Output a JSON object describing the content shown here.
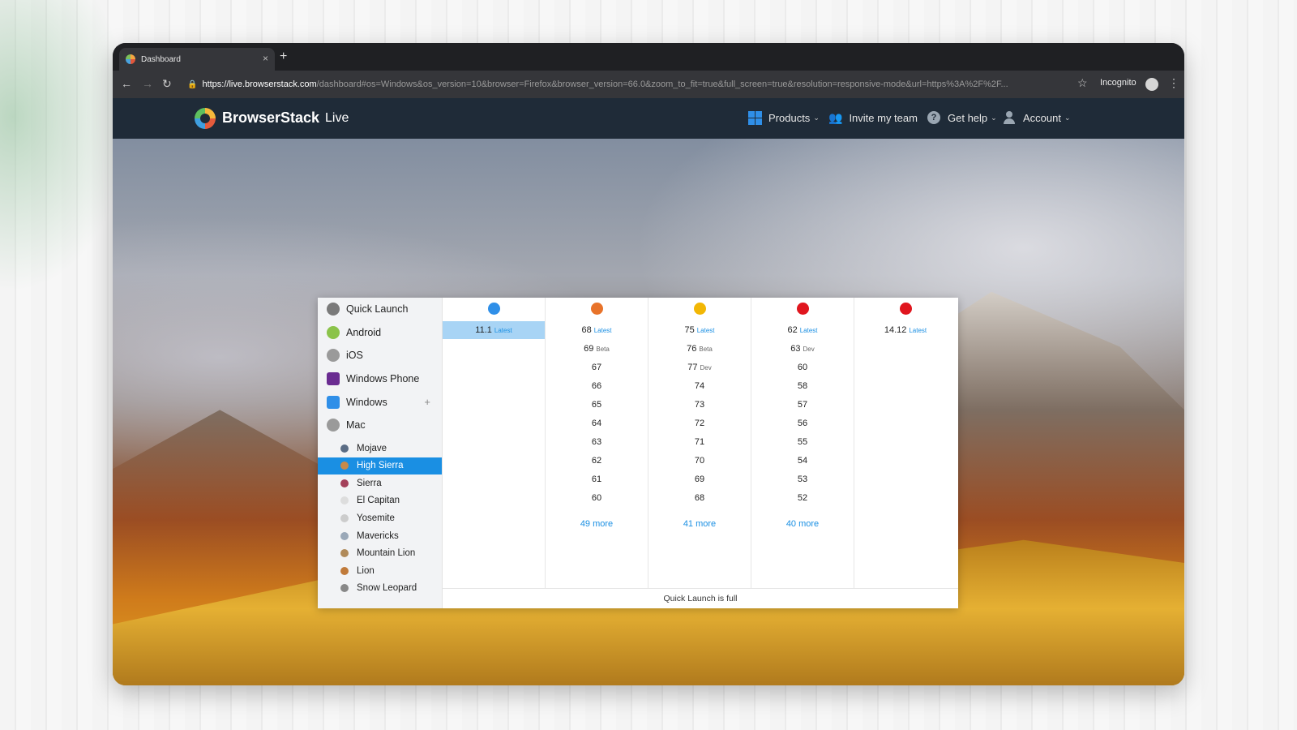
{
  "browser": {
    "tab_title": "Dashboard",
    "url_host": "https://live.browserstack.com",
    "url_path": "/dashboard#os=Windows&os_version=10&browser=Firefox&browser_version=66.0&zoom_to_fit=true&full_screen=true&resolution=responsive-mode&url=https%3A%2F%2F...",
    "incognito_label": "Incognito",
    "new_tab_label": "+",
    "close_tab_label": "×"
  },
  "header": {
    "brand": "BrowserStack",
    "product": "Live",
    "nav": [
      {
        "label": "Products",
        "icon": "grid-icon"
      },
      {
        "label": "Invite my team",
        "icon": "invite-icon"
      },
      {
        "label": "Get help",
        "icon": "help-icon"
      },
      {
        "label": "Account",
        "icon": "user-icon"
      }
    ]
  },
  "os_list": [
    {
      "label": "Quick Launch",
      "icon": "rocket-icon",
      "color": "#7a7a7a"
    },
    {
      "label": "Android",
      "icon": "android-icon",
      "color": "#8bc34a"
    },
    {
      "label": "iOS",
      "icon": "apple-icon",
      "color": "#9a9a9a"
    },
    {
      "label": "Windows Phone",
      "icon": "windows-phone-icon",
      "color": "#6a2c91"
    },
    {
      "label": "Windows",
      "icon": "windows-icon",
      "color": "#2f8fe8",
      "expand": "+"
    },
    {
      "label": "Mac",
      "icon": "apple-icon",
      "color": "#9a9a9a"
    }
  ],
  "mac_versions": [
    {
      "label": "Mojave",
      "color": "#5a6c84"
    },
    {
      "label": "High Sierra",
      "color": "#c78a4a",
      "active": true
    },
    {
      "label": "Sierra",
      "color": "#a3405a"
    },
    {
      "label": "El Capitan",
      "color": "#dddddd"
    },
    {
      "label": "Yosemite",
      "color": "#cccccc"
    },
    {
      "label": "Mavericks",
      "color": "#9aa8b8"
    },
    {
      "label": "Mountain Lion",
      "color": "#b08a5a"
    },
    {
      "label": "Lion",
      "color": "#c07a3a"
    },
    {
      "label": "Snow Leopard",
      "color": "#888888"
    }
  ],
  "browsers": [
    {
      "name": "safari",
      "color": "#2f8fe8",
      "versions": [
        {
          "v": "11.1",
          "tag": "Latest",
          "selected": true
        }
      ],
      "more": ""
    },
    {
      "name": "firefox",
      "color": "#e8732a",
      "versions": [
        {
          "v": "68",
          "tag": "Latest"
        },
        {
          "v": "69",
          "tag": "Beta"
        },
        {
          "v": "67",
          "tag": ""
        },
        {
          "v": "66",
          "tag": ""
        },
        {
          "v": "65",
          "tag": ""
        },
        {
          "v": "64",
          "tag": ""
        },
        {
          "v": "63",
          "tag": ""
        },
        {
          "v": "62",
          "tag": ""
        },
        {
          "v": "61",
          "tag": ""
        },
        {
          "v": "60",
          "tag": ""
        }
      ],
      "more": "49 more"
    },
    {
      "name": "chrome",
      "color": "#f2b705",
      "versions": [
        {
          "v": "75",
          "tag": "Latest"
        },
        {
          "v": "76",
          "tag": "Beta"
        },
        {
          "v": "77",
          "tag": "Dev"
        },
        {
          "v": "74",
          "tag": ""
        },
        {
          "v": "73",
          "tag": ""
        },
        {
          "v": "72",
          "tag": ""
        },
        {
          "v": "71",
          "tag": ""
        },
        {
          "v": "70",
          "tag": ""
        },
        {
          "v": "69",
          "tag": ""
        },
        {
          "v": "68",
          "tag": ""
        }
      ],
      "more": "41 more"
    },
    {
      "name": "opera",
      "color": "#e0161e",
      "versions": [
        {
          "v": "62",
          "tag": "Latest"
        },
        {
          "v": "63",
          "tag": "Dev"
        },
        {
          "v": "60",
          "tag": ""
        },
        {
          "v": "58",
          "tag": ""
        },
        {
          "v": "57",
          "tag": ""
        },
        {
          "v": "56",
          "tag": ""
        },
        {
          "v": "55",
          "tag": ""
        },
        {
          "v": "54",
          "tag": ""
        },
        {
          "v": "53",
          "tag": ""
        },
        {
          "v": "52",
          "tag": ""
        }
      ],
      "more": "40 more"
    },
    {
      "name": "yandex",
      "color": "#e0161e",
      "versions": [
        {
          "v": "14.12",
          "tag": "Latest"
        }
      ],
      "more": ""
    }
  ],
  "footer_text": "Quick Launch is full"
}
